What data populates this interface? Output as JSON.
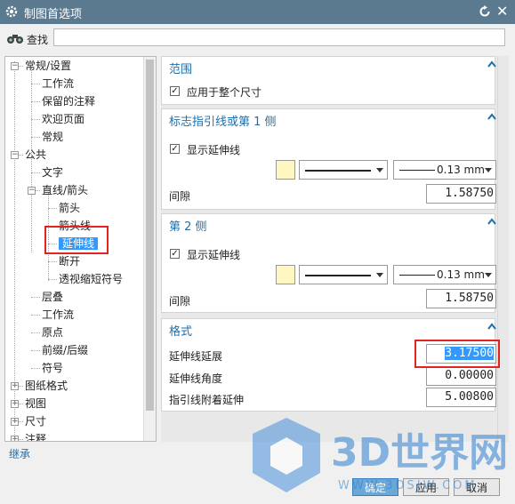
{
  "title": "制图首选项",
  "search": {
    "label": "查找",
    "value": ""
  },
  "tree": [
    {
      "label": "常规/设置",
      "level": 0,
      "expander": "−"
    },
    {
      "label": "工作流",
      "level": 1
    },
    {
      "label": "保留的注释",
      "level": 1
    },
    {
      "label": "欢迎页面",
      "level": 1
    },
    {
      "label": "常规",
      "level": 1
    },
    {
      "label": "公共",
      "level": 0,
      "expander": "−"
    },
    {
      "label": "文字",
      "level": 1
    },
    {
      "label": "直线/箭头",
      "level": 1,
      "expander": "−"
    },
    {
      "label": "箭头",
      "level": 2
    },
    {
      "label": "箭头线",
      "level": 2
    },
    {
      "label": "延伸线",
      "level": 2,
      "selected": true
    },
    {
      "label": "断开",
      "level": 2
    },
    {
      "label": "透视缩短符号",
      "level": 2
    },
    {
      "label": "层叠",
      "level": 1
    },
    {
      "label": "工作流",
      "level": 1
    },
    {
      "label": "原点",
      "level": 1
    },
    {
      "label": "前缀/后缀",
      "level": 1
    },
    {
      "label": "符号",
      "level": 1
    },
    {
      "label": "图纸格式",
      "level": 0,
      "expander": "+"
    },
    {
      "label": "视图",
      "level": 0,
      "expander": "+"
    },
    {
      "label": "尺寸",
      "level": 0,
      "expander": "+"
    },
    {
      "label": "注释",
      "level": 0,
      "expander": "+"
    }
  ],
  "sections": {
    "scope": {
      "header": "范围",
      "checkbox": "应用于整个尺寸"
    },
    "side1": {
      "header": "标志指引线或第 1 侧",
      "checkbox": "显示延伸线",
      "width": "0.13 mm",
      "gap_label": "间隙",
      "gap_value": "1.58750"
    },
    "side2": {
      "header": "第 2 侧",
      "checkbox": "显示延伸线",
      "width": "0.13 mm",
      "gap_label": "间隙",
      "gap_value": "1.58750"
    },
    "format": {
      "header": "格式",
      "rows": [
        {
          "label": "延伸线延展",
          "value": "3.17500"
        },
        {
          "label": "延伸线角度",
          "value": "0.00000"
        },
        {
          "label": "指引线附着延伸",
          "value": "5.00800"
        }
      ]
    }
  },
  "inherit": "继承",
  "buttons": {
    "ok": "确定",
    "apply": "应用",
    "cancel": "取消"
  },
  "watermark": {
    "brand": "3D世界网",
    "url": "WWW.3DSJW.COM"
  },
  "colors": {
    "title_bar": "#5b7a8f",
    "section_header": "#1f6fa8",
    "selection": "#3399ff",
    "highlight_box": "#e32222",
    "swatch": "#fff7c2"
  }
}
